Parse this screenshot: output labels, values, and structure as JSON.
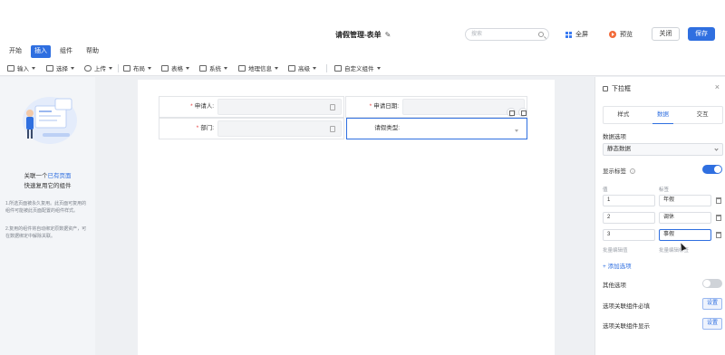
{
  "header": {
    "title": "请假管理-表单",
    "search_placeholder": "搜索",
    "fullscreen_label": "全屏",
    "preview_label": "预览",
    "close_label": "关闭",
    "save_label": "保存"
  },
  "menu": {
    "tabs": [
      "开始",
      "插入",
      "组件",
      "帮助"
    ],
    "active": "插入"
  },
  "toolbar": {
    "items": [
      "输入",
      "选择",
      "上传",
      "布局",
      "表格",
      "系统",
      "地理信息",
      "高级",
      "自定义组件"
    ]
  },
  "left_panel": {
    "heading_prefix": "关联一个",
    "heading_link": "已有页面",
    "subheading": "快速复用它的组件",
    "note1": "1.所选页面被永久复用。此页面可复用的组件可能被此页面配置的组件样式。",
    "note2": "2.复用的组件将自动绑定原数据资产，可在数据绑定中解除关联。"
  },
  "form": {
    "fields": [
      {
        "label": "申请人:",
        "required": true
      },
      {
        "label": "申请日期:",
        "required": true
      },
      {
        "label": "部门:",
        "required": true
      },
      {
        "label": "请假类型:",
        "required": false
      }
    ]
  },
  "properties": {
    "title": "下拉框",
    "tabs": [
      "样式",
      "数据",
      "交互"
    ],
    "active_tab": "数据",
    "data_options_label": "数据选项",
    "data_source_value": "静态数据",
    "show_label_text": "显示标签",
    "show_label_on": true,
    "value_header": "值",
    "label_header": "标签",
    "options": [
      {
        "value": "1",
        "label": "年假"
      },
      {
        "value": "2",
        "label": "调休"
      },
      {
        "value": "3",
        "label": "事假"
      }
    ],
    "bulk_edit_value": "批量编辑值",
    "bulk_edit_label": "批量编辑标签",
    "add_option": "+ 添加选项",
    "other_option_label": "其他选项",
    "other_option_on": false,
    "required_link_label": "选项关联组件必填",
    "display_link_label": "选项关联组件显示",
    "settings_label": "设置",
    "accent_color": "#2f6fe0"
  }
}
